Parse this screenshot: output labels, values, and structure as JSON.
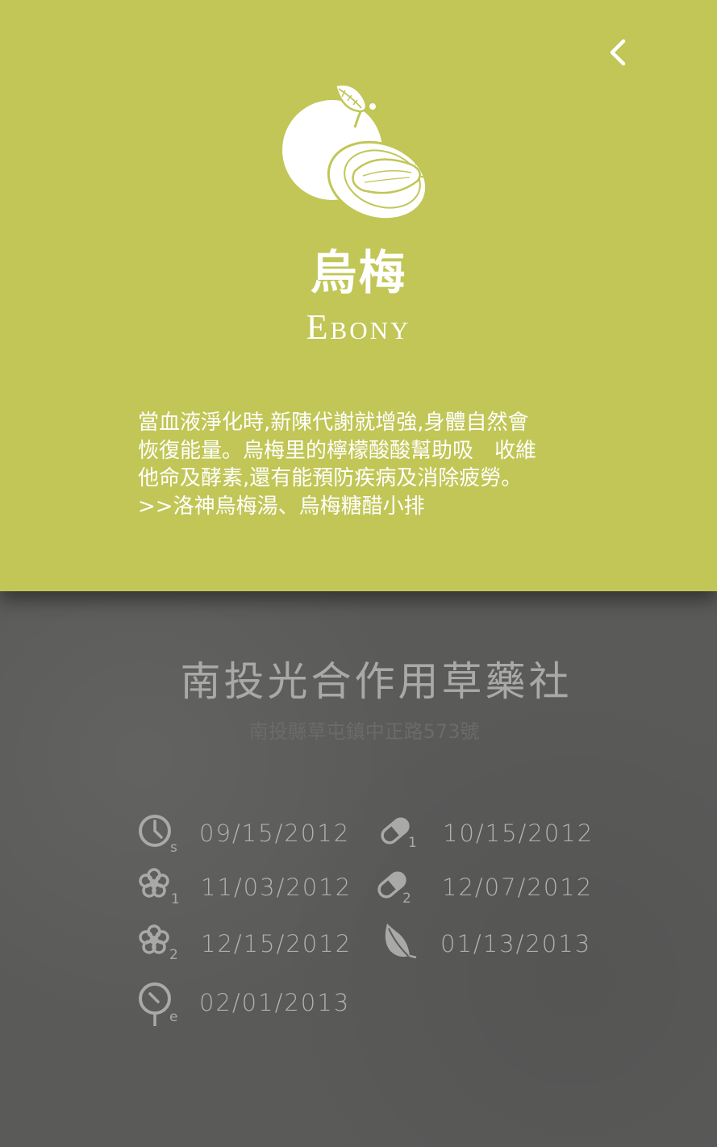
{
  "header": {
    "back_icon": "chevron-left-icon",
    "illustration_icon": "plum-fruit-icon",
    "title_zh": "烏梅",
    "title_en": "Ebony",
    "description_lines": [
      "當血液淨化時,新陳代謝就增強,身體自然會",
      "恢復能量。烏梅里的檸檬酸酸幫助吸　收維",
      "他命及酵素,還有能預防疾病及消除疲勞。",
      ">>洛神烏梅湯、烏梅糖醋小排"
    ],
    "bg_color": "#c1c656"
  },
  "shop": {
    "name": "南投光合作用草藥社",
    "address": "南投縣草屯鎮中正路573號",
    "bg_color": "#5a5a59"
  },
  "schedule": [
    {
      "icon": "clock-icon",
      "sub": "s",
      "date": "09/15/2012"
    },
    {
      "icon": "pill-icon",
      "sub": "1",
      "date": "10/15/2012"
    },
    {
      "icon": "flower-icon",
      "sub": "1",
      "date": "11/03/2012"
    },
    {
      "icon": "pill-icon",
      "sub": "2",
      "date": "12/07/2012"
    },
    {
      "icon": "flower-icon",
      "sub": "2",
      "date": "12/15/2012"
    },
    {
      "icon": "leaf-icon",
      "sub": "",
      "date": "01/13/2013"
    },
    {
      "icon": "timer-icon",
      "sub": "e",
      "date": "02/01/2013"
    }
  ]
}
